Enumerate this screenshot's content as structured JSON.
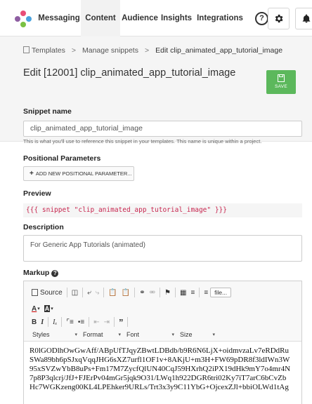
{
  "nav": {
    "tabs": [
      {
        "label": "Messaging",
        "active": false
      },
      {
        "label": "Content",
        "active": true
      },
      {
        "label": "Audience",
        "active": false
      },
      {
        "label": "Insights",
        "active": false
      },
      {
        "label": "Integrations",
        "active": false
      }
    ],
    "icons": [
      "help-icon",
      "gear-icon",
      "bell-icon"
    ],
    "logo_colors": [
      "#e94e77",
      "#4aa3df",
      "#7ac143",
      "#8e5ea2"
    ]
  },
  "breadcrumb": {
    "items": [
      "Templates",
      "Manage snippets",
      "Edit clip_animated_app_tutorial_image"
    ],
    "separator": ">"
  },
  "page": {
    "title": "Edit [12001] clip_animated_app_tutorial_image",
    "save_label": "SAVE",
    "save_color": "#5cb85c"
  },
  "form": {
    "snippet_name_label": "Snippet name",
    "snippet_name_value": "clip_animated_app_tutorial_image",
    "snippet_name_help": "This is what you'll use to reference this snippet in your templates. This name is unique within a project.",
    "positional_label": "Positional Parameters",
    "add_param_label": "ADD NEW POSITIONAL PARAMETER...",
    "preview_label": "Preview",
    "preview_code": "{{{ snippet \"clip_animated_app_tutorial_image\" }}}",
    "description_label": "Description",
    "description_value": "For Generic App Tutorials (animated)",
    "markup_label": "Markup"
  },
  "editor": {
    "source_label": "Source",
    "file_label": "file...",
    "styles_label": "Styles",
    "format_label": "Format",
    "font_label": "Font",
    "size_label": "Size",
    "content_lines": [
      "R0lGODlhOwGwAff/ABpUfTJqyZBwtLDBdb/b9R6N6LjX+oidmvzaLv7eRDdRu",
      "SWa89bh6pSJxqVqqJHG6sXZ7urfl1OF1v+8AKjU+m3H+FW69pDR8f3ldIWn3W",
      "95xSVZwYbB8uPs+Fm17M7ZycfQlUN40CqJ59HXrhQ2iPX19dHk9mY7o4mr4N",
      "7p8P3qlcrj/JfJ+FJErPv04mGr5jqk9O31/LWq1h922DGR6tri02Ky7iT7arC6bCvZb",
      "Hc7WGKzeng00KL4LPEhker9URLs/Trt3x3y9C11YbG+OjcexZJl+bbiOLWd1tAg"
    ]
  }
}
